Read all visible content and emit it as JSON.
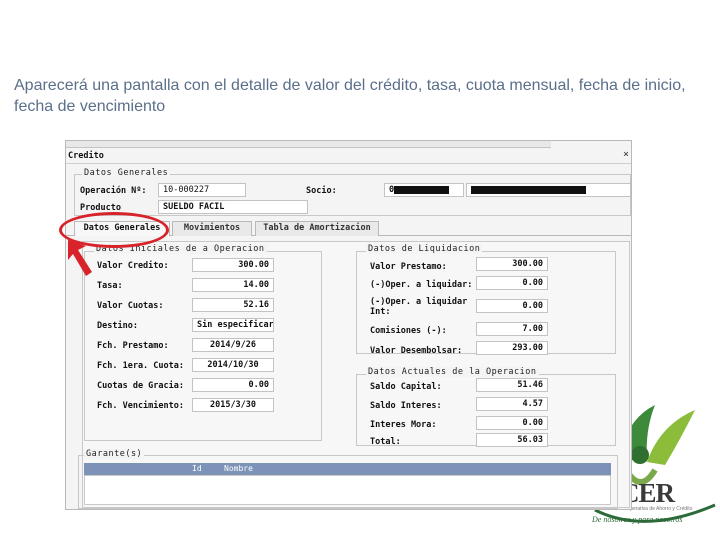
{
  "caption": "Aparecerá una pantalla con el detalle de valor del crédito, tasa, cuota mensual, fecha de inicio, fecha de vencimiento",
  "window": {
    "title": "Credito",
    "close_glyph": "×",
    "datos_generales_legend": "Datos Generales",
    "operacion_label": "Operación Nº:",
    "operacion_value": "10-000227",
    "socio_label": "Socio:",
    "socio_value": "0",
    "producto_label": "Producto",
    "producto_value": "SUELDO FACIL"
  },
  "tabs": [
    {
      "label": "Datos Generales",
      "active": true
    },
    {
      "label": "Movimientos",
      "active": false
    },
    {
      "label": "Tabla de Amortizacion",
      "active": false
    }
  ],
  "datos_iniciales": {
    "legend": "Datos Iniciales de a Operacion",
    "rows": [
      {
        "label": "Valor Credito:",
        "value": "300.00",
        "align": "right"
      },
      {
        "label": "Tasa:",
        "value": "14.00",
        "align": "right"
      },
      {
        "label": "Valor Cuotas:",
        "value": "52.16",
        "align": "right"
      },
      {
        "label": "Destino:",
        "value": "Sin especificar",
        "align": "left"
      },
      {
        "label": "Fch. Prestamo:",
        "value": "2014/9/26",
        "align": "center"
      },
      {
        "label": "Fch. 1era. Cuota:",
        "value": "2014/10/30",
        "align": "center"
      },
      {
        "label": "Cuotas de Gracia:",
        "value": "0.00",
        "align": "right"
      },
      {
        "label": "Fch. Vencimiento:",
        "value": "2015/3/30",
        "align": "center"
      }
    ]
  },
  "datos_liquidacion": {
    "legend": "Datos de Liquidacion",
    "valor_prestamo_label": "Valor Prestamo:",
    "valor_prestamo": "300.00",
    "oper_liquidar_label": "(-)Oper. a liquidar:",
    "oper_liquidar": "0.00",
    "oper_liquidar_int_label": "(-)Oper. a liquidar Int:",
    "oper_liquidar_int": "0.00",
    "comisiones_label": "Comisiones (-):",
    "comisiones": "7.00",
    "valor_desembolsar_label": "Valor Desembolsar:",
    "valor_desembolsar": "293.00"
  },
  "datos_actuales": {
    "legend": "Datos Actuales de la Operacion",
    "saldo_capital_label": "Saldo Capital:",
    "saldo_capital": "51.46",
    "saldo_interes_label": "Saldo Interes:",
    "saldo_interes": "4.57",
    "interes_mora_label": "Interes Mora:",
    "interes_mora": "0.00",
    "total_label": "Total:",
    "total": "56.03"
  },
  "garante": {
    "legend": "Garante(s)",
    "columns": [
      "Id",
      "Nombre"
    ]
  },
  "logo": {
    "text": "CER",
    "subtext": "Cooperativa de Ahorro y Crédito",
    "tagline": "De nosotros y para nosotros"
  },
  "colors": {
    "highlight": "#d8232a",
    "grid_header": "#7c92b7",
    "caption": "#5a6f8a",
    "logo_green": "#3d8a3a"
  }
}
